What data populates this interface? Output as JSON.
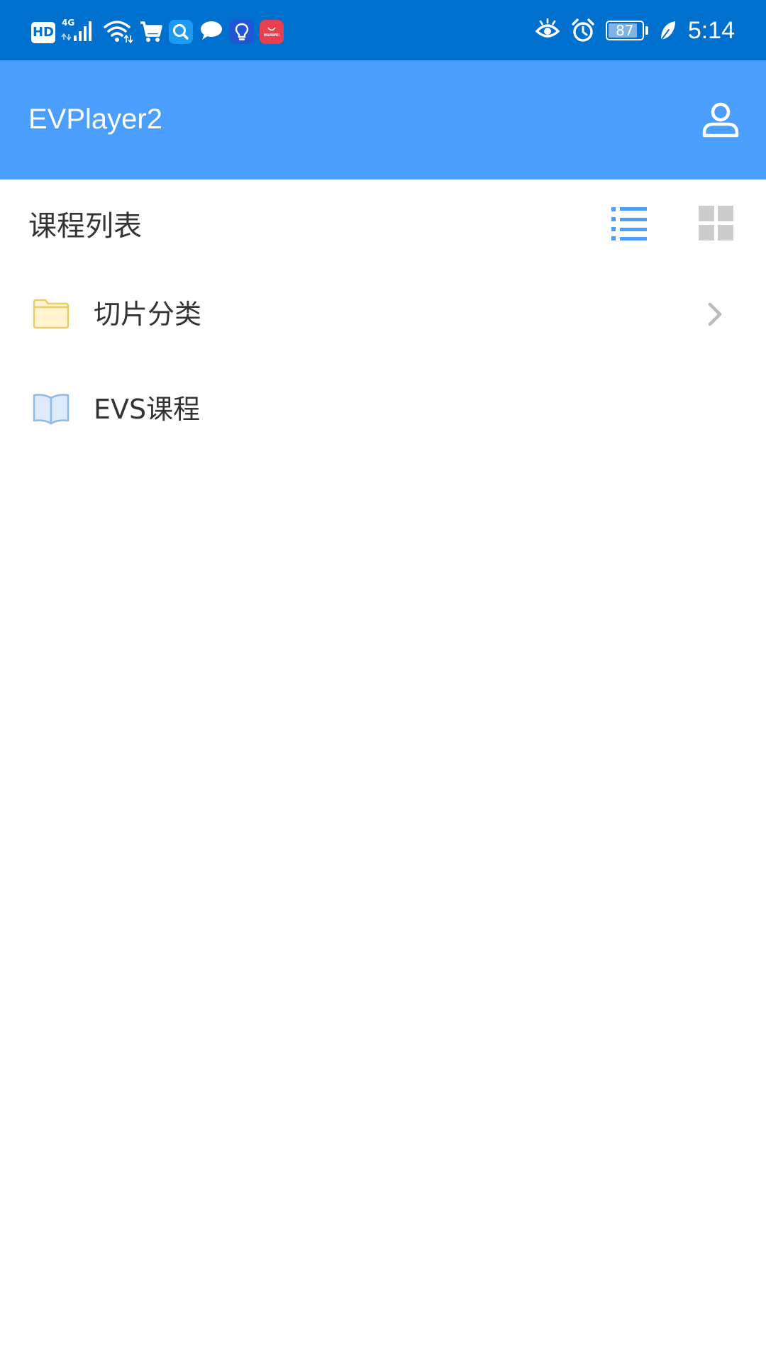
{
  "status_bar": {
    "left_icons": [
      "hd-icon",
      "signal-4g-icon",
      "wifi-icon",
      "cart-icon",
      "search-app-icon",
      "chat-icon",
      "lightbulb-icon",
      "huawei-app-icon"
    ],
    "hd_label": "HD",
    "network_label": "4G",
    "huawei_label": "HUAWEI",
    "right_icons": [
      "eye-comfort-icon",
      "alarm-icon",
      "battery-icon",
      "leaf-icon"
    ],
    "battery_level": "87",
    "battery_fraction": 0.87,
    "time": "5:14",
    "colors": {
      "background": "#0070CE",
      "search_app": "#1E9BF0",
      "lightbulb_app": "#2255D6",
      "huawei_app": "#E8404E"
    }
  },
  "app_bar": {
    "title": "EVPlayer2",
    "profile_icon": "user-icon",
    "background": "#4C9EFD"
  },
  "section": {
    "title": "课程列表",
    "view_modes": [
      {
        "name": "list",
        "icon": "list-view-icon",
        "active": true,
        "color": "#4C9EFD"
      },
      {
        "name": "grid",
        "icon": "grid-view-icon",
        "active": false,
        "color": "#CCCCCC"
      }
    ]
  },
  "courses": [
    {
      "label": "切片分类",
      "icon": "folder-icon",
      "has_chevron": true
    },
    {
      "label": "EVS课程",
      "icon": "book-icon",
      "has_chevron": false
    }
  ]
}
